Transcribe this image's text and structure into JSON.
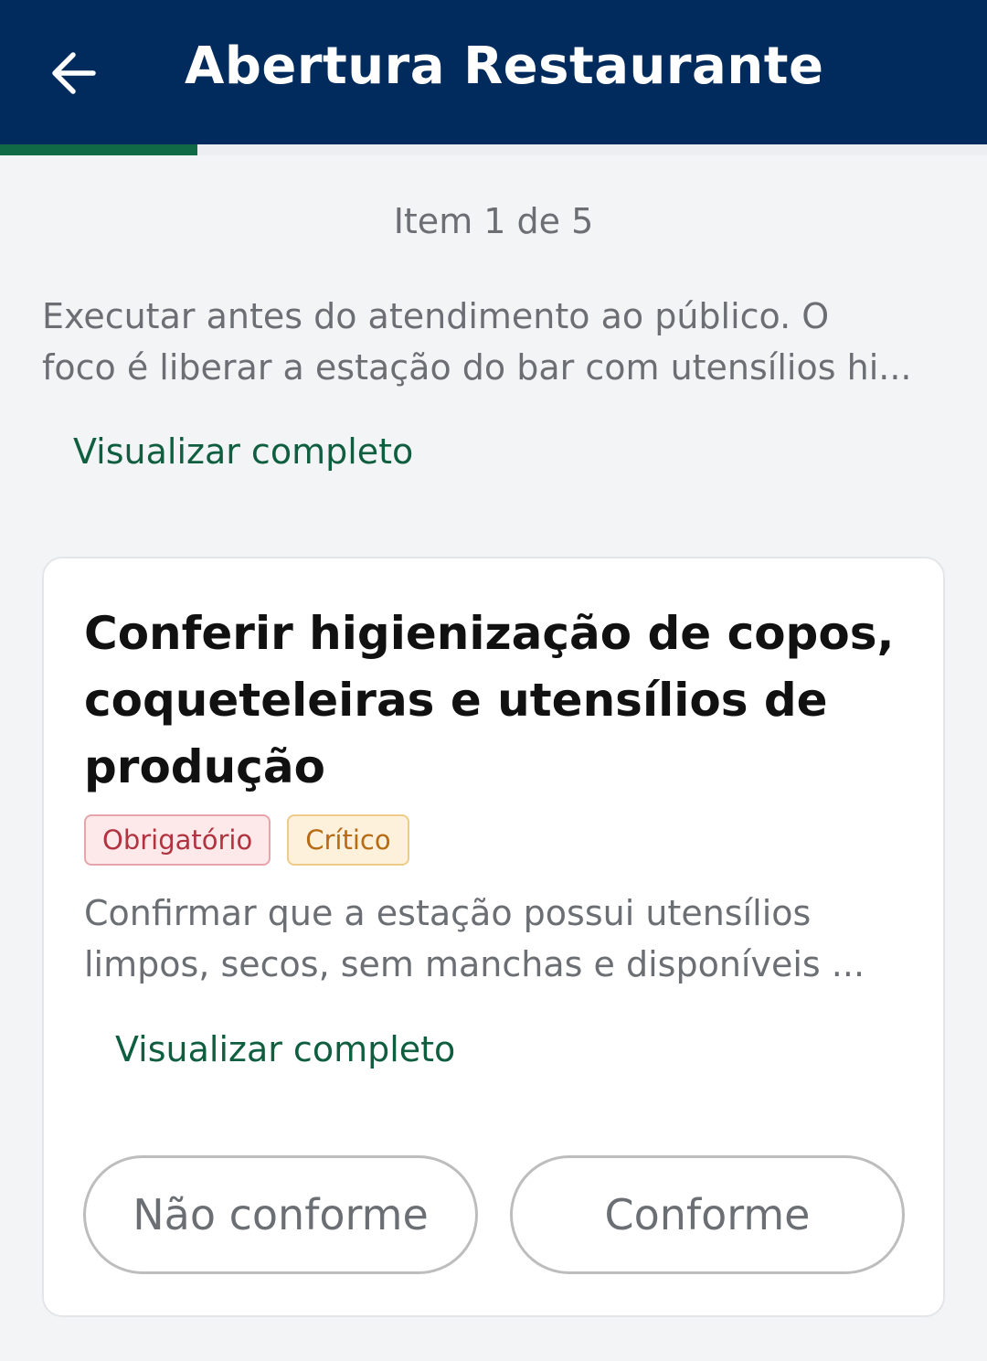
{
  "header": {
    "title": "Abertura Restaurante",
    "back_icon": "arrow-left-icon",
    "background": "#012b5c"
  },
  "progress": {
    "fraction": 0.2,
    "color": "#0f6a45"
  },
  "counter": "Item 1 de 5",
  "section": {
    "description_line1": "Executar antes do atendimento ao público. O",
    "description_line2": "foco é liberar a estação do bar com utensílios hi...",
    "view_full_label": "Visualizar completo"
  },
  "item": {
    "title": "Conferir higienização de copos, coqueteleiras e utensílios de produção",
    "badges": {
      "required": "Obrigatório",
      "critical": "Crítico"
    },
    "description_line1": "Confirmar que a estação possui utensílios",
    "description_line2": "limpos, secos, sem manchas e disponíveis ...",
    "view_full_label": "Visualizar completo",
    "actions": {
      "noncompliant": "Não conforme",
      "compliant": "Conforme"
    }
  },
  "colors": {
    "accent_green": "#0f5e3f",
    "required_red": "#b1333f",
    "critical_orange": "#b86b12"
  }
}
